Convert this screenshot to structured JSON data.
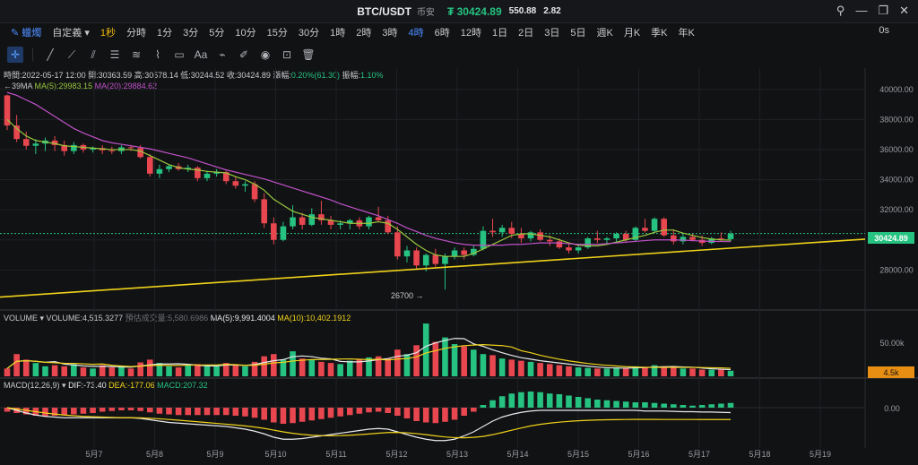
{
  "title": {
    "pair": "BTC/USDT",
    "exchange": "币安",
    "price": "₮ 30424.89",
    "change": "550.88",
    "percent": "2.82"
  },
  "toolbar": {
    "chart_type": "蠟燭",
    "custom": "自定義",
    "intervals": [
      "1秒",
      "分時",
      "1分",
      "3分",
      "5分",
      "10分",
      "15分",
      "30分",
      "1時",
      "2時",
      "3時",
      "4時",
      "6時",
      "12時",
      "1日",
      "2日",
      "3日",
      "5日",
      "週K",
      "月K",
      "季K",
      "年K"
    ],
    "active_interval": "4時",
    "highlight_interval": "1秒",
    "zero": "0s"
  },
  "info": {
    "time_label": "時間:",
    "time": "2022-05-17 12:00",
    "open_label": "開:",
    "open": "30363.59",
    "high_label": "高:",
    "high": "30578.14",
    "low_label": "低:",
    "low": "30244.52",
    "close_label": "收:",
    "close": "30424.89",
    "chg_label": "漲幅:",
    "chg": "0.20%(61.30)",
    "amp_label": "振幅:",
    "amp": "1.10%"
  },
  "legend": {
    "ma_prefix": "←39MA",
    "ma_partial": "MA",
    "ma5": "MA(5):29983.15",
    "ma20": "MA(20):29884.62",
    "volume": "VOLUME",
    "volume_val": "VOLUME:4,515.3277",
    "est": "預估成交量:5,580.6986",
    "vma5": "MA(5):9,991.4004",
    "vma10": "MA(10):10,402.1912",
    "macd": "MACD(12,26,9)",
    "dif": "DIF:-73.40",
    "dea": "DEA:-177.06",
    "macd_val": "MACD:207.32"
  },
  "annotations": {
    "low_marker": "26700 →",
    "price_tag": "30424.89",
    "vol_tag": "4.5k",
    "vol_axis": "50.00k",
    "macd_axis": "0.00"
  },
  "colors": {
    "up": "#26c281",
    "down": "#e8474f",
    "ma5": "#9ac83e",
    "ma20": "#c052c8",
    "trend": "#f0d21a",
    "bg": "#111214"
  },
  "chart_data": {
    "type": "candlestick",
    "x_labels": [
      "5月7",
      "5月8",
      "5月9",
      "5月10",
      "5月11",
      "5月12",
      "5月13",
      "5月14",
      "5月15",
      "5月16",
      "5月17",
      "5月18",
      "5月19"
    ],
    "y_ticks": [
      28000,
      30000,
      32000,
      34000,
      36000,
      38000,
      40000
    ],
    "ylim": [
      25400,
      40700
    ],
    "candles": [
      [
        39600,
        39650,
        37300,
        37600
      ],
      [
        37600,
        38300,
        36500,
        36700
      ],
      [
        36700,
        37200,
        36000,
        36250
      ],
      [
        36250,
        36700,
        35700,
        36400
      ],
      [
        36400,
        36800,
        35900,
        36600
      ],
      [
        36600,
        36900,
        35900,
        36300
      ],
      [
        36300,
        36600,
        35600,
        35900
      ],
      [
        35900,
        36500,
        35700,
        36300
      ],
      [
        36300,
        36400,
        35800,
        36000
      ],
      [
        36000,
        36200,
        35800,
        36100
      ],
      [
        36100,
        36300,
        35700,
        35950
      ],
      [
        35950,
        36200,
        35700,
        35900
      ],
      [
        35900,
        36300,
        35700,
        36150
      ],
      [
        36150,
        36300,
        35900,
        36100
      ],
      [
        36100,
        36300,
        35400,
        35500
      ],
      [
        35500,
        35700,
        34200,
        34400
      ],
      [
        34400,
        35000,
        34100,
        34700
      ],
      [
        34700,
        35000,
        34500,
        34900
      ],
      [
        34900,
        35100,
        34600,
        34700
      ],
      [
        34700,
        35000,
        34500,
        34800
      ],
      [
        34800,
        34900,
        33900,
        34100
      ],
      [
        34100,
        34600,
        33900,
        34400
      ],
      [
        34400,
        34700,
        34200,
        34500
      ],
      [
        34500,
        34600,
        33700,
        33900
      ],
      [
        33900,
        34200,
        33400,
        33600
      ],
      [
        33600,
        33900,
        33200,
        33700
      ],
      [
        33700,
        33900,
        32500,
        32700
      ],
      [
        32700,
        33100,
        30800,
        31100
      ],
      [
        31100,
        31500,
        29700,
        30000
      ],
      [
        30000,
        31200,
        29900,
        30900
      ],
      [
        30900,
        32300,
        30700,
        31500
      ],
      [
        31500,
        31800,
        30700,
        31000
      ],
      [
        31000,
        32100,
        30900,
        31700
      ],
      [
        31700,
        32600,
        31000,
        31300
      ],
      [
        31300,
        31600,
        30700,
        31000
      ],
      [
        31000,
        31300,
        30700,
        31100
      ],
      [
        31100,
        31400,
        30700,
        31300
      ],
      [
        31300,
        31500,
        30700,
        30900
      ],
      [
        30900,
        31600,
        30700,
        31500
      ],
      [
        31500,
        32200,
        31200,
        31300
      ],
      [
        31300,
        31600,
        30400,
        30500
      ],
      [
        30500,
        30900,
        28700,
        28900
      ],
      [
        28900,
        29600,
        28500,
        29300
      ],
      [
        29300,
        29500,
        28000,
        28300
      ],
      [
        28300,
        29100,
        27900,
        29000
      ],
      [
        29000,
        29400,
        28200,
        28400
      ],
      [
        28400,
        29100,
        26700,
        28900
      ],
      [
        28900,
        29500,
        28700,
        29300
      ],
      [
        29300,
        29500,
        28700,
        29000
      ],
      [
        29000,
        29600,
        28900,
        29400
      ],
      [
        29400,
        30900,
        29300,
        30600
      ],
      [
        30600,
        31400,
        30200,
        30500
      ],
      [
        30500,
        31000,
        30200,
        30800
      ],
      [
        30800,
        31200,
        30100,
        30400
      ],
      [
        30400,
        30800,
        29800,
        30100
      ],
      [
        30100,
        30600,
        29900,
        30500
      ],
      [
        30500,
        30700,
        29900,
        30000
      ],
      [
        30000,
        30300,
        29600,
        29900
      ],
      [
        29900,
        30100,
        29400,
        29500
      ],
      [
        29500,
        29800,
        29100,
        29300
      ],
      [
        29300,
        29700,
        29100,
        29500
      ],
      [
        29500,
        30200,
        29400,
        30100
      ],
      [
        30100,
        30600,
        29800,
        30000
      ],
      [
        30000,
        30200,
        29700,
        30100
      ],
      [
        30100,
        30500,
        29800,
        30400
      ],
      [
        30400,
        30600,
        29800,
        30000
      ],
      [
        30000,
        30900,
        29900,
        30800
      ],
      [
        30800,
        31400,
        30500,
        30600
      ],
      [
        30600,
        31500,
        30500,
        31400
      ],
      [
        31400,
        31500,
        30200,
        30300
      ],
      [
        30300,
        30700,
        29700,
        29900
      ],
      [
        29900,
        30400,
        29700,
        30200
      ],
      [
        30200,
        30400,
        29900,
        30000
      ],
      [
        30000,
        30300,
        29600,
        29800
      ],
      [
        29800,
        30200,
        29700,
        30100
      ],
      [
        30100,
        30500,
        29900,
        30050
      ],
      [
        30050,
        30600,
        29900,
        30400
      ]
    ],
    "volumes": [
      14,
      40,
      30,
      24,
      18,
      20,
      18,
      22,
      16,
      14,
      20,
      16,
      18,
      14,
      25,
      30,
      24,
      18,
      16,
      20,
      22,
      18,
      18,
      24,
      20,
      18,
      26,
      36,
      40,
      30,
      45,
      32,
      30,
      26,
      24,
      22,
      28,
      30,
      34,
      36,
      32,
      48,
      40,
      56,
      95,
      62,
      70,
      58,
      54,
      48,
      40,
      38,
      32,
      30,
      28,
      26,
      24,
      22,
      20,
      18,
      16,
      15,
      14,
      14,
      16,
      14,
      18,
      16,
      20,
      18,
      16,
      14,
      14,
      12,
      12,
      12,
      10
    ],
    "ma5": [
      38000,
      37400,
      36900,
      36600,
      36500,
      36400,
      36250,
      36200,
      36150,
      36100,
      36050,
      36000,
      36000,
      36000,
      35900,
      35600,
      35300,
      35000,
      34800,
      34700,
      34650,
      34550,
      34500,
      34450,
      34200,
      34000,
      33700,
      33300,
      32700,
      32300,
      31900,
      31700,
      31500,
      31400,
      31300,
      31200,
      31100,
      31100,
      31100,
      31200,
      31100,
      30700,
      30200,
      29700,
      29300,
      29000,
      28900,
      28900,
      28900,
      29100,
      29400,
      29700,
      30000,
      30300,
      30400,
      30400,
      30300,
      30200,
      30000,
      29800,
      29650,
      29600,
      29600,
      29700,
      29850,
      30000,
      30150,
      30300,
      30500,
      30650,
      30650,
      30450,
      30300,
      30150,
      30050,
      30000,
      29983
    ],
    "ma20": [
      39800,
      39600,
      39300,
      39000,
      38600,
      38200,
      37800,
      37400,
      37100,
      36850,
      36600,
      36450,
      36350,
      36250,
      36150,
      36050,
      35900,
      35750,
      35600,
      35450,
      35250,
      35050,
      34850,
      34650,
      34500,
      34350,
      34200,
      34050,
      33850,
      33650,
      33450,
      33250,
      33050,
      32850,
      32650,
      32400,
      32200,
      32000,
      31800,
      31600,
      31350,
      31100,
      30800,
      30550,
      30300,
      30100,
      29950,
      29800,
      29700,
      29650,
      29650,
      29650,
      29650,
      29700,
      29700,
      29750,
      29800,
      29800,
      29800,
      29750,
      29700,
      29700,
      29700,
      29750,
      29800,
      29850,
      29900,
      29950,
      30000,
      30000,
      30000,
      29980,
      29950,
      29920,
      29900,
      29890,
      29885
    ],
    "macd_hist": [
      -60,
      -80,
      -100,
      -120,
      -130,
      -120,
      -110,
      -100,
      -90,
      -80,
      -60,
      -50,
      -40,
      -40,
      -50,
      -70,
      -90,
      -100,
      -110,
      -110,
      -110,
      -110,
      -110,
      -110,
      -120,
      -130,
      -150,
      -180,
      -220,
      -240,
      -230,
      -210,
      -190,
      -170,
      -150,
      -130,
      -110,
      -90,
      -70,
      -60,
      -80,
      -120,
      -160,
      -200,
      -220,
      -230,
      -210,
      -180,
      -120,
      -60,
      40,
      110,
      170,
      210,
      230,
      240,
      230,
      210,
      200,
      180,
      160,
      140,
      120,
      110,
      100,
      90,
      80,
      80,
      70,
      60,
      50,
      40,
      30,
      40,
      50,
      60,
      70
    ],
    "macd_dif": [
      0,
      -40,
      -80,
      -110,
      -130,
      -140,
      -150,
      -150,
      -150,
      -150,
      -150,
      -150,
      -150,
      -150,
      -160,
      -180,
      -200,
      -220,
      -230,
      -240,
      -250,
      -260,
      -270,
      -280,
      -300,
      -320,
      -350,
      -390,
      -440,
      -470,
      -470,
      -460,
      -440,
      -420,
      -400,
      -380,
      -360,
      -340,
      -320,
      -310,
      -320,
      -360,
      -400,
      -440,
      -470,
      -490,
      -490,
      -470,
      -420,
      -360,
      -280,
      -200,
      -140,
      -100,
      -70,
      -50,
      -40,
      -40,
      -40,
      -40,
      -40,
      -40,
      -40,
      -40,
      -40,
      -40,
      -40,
      -50,
      -50,
      -50,
      -55,
      -60,
      -60,
      -65,
      -65,
      -70,
      -73
    ],
    "macd_dea": [
      0,
      -20,
      -40,
      -60,
      -80,
      -95,
      -110,
      -120,
      -130,
      -135,
      -140,
      -145,
      -148,
      -150,
      -152,
      -158,
      -166,
      -176,
      -187,
      -198,
      -210,
      -222,
      -234,
      -246,
      -258,
      -272,
      -288,
      -308,
      -334,
      -360,
      -382,
      -398,
      -410,
      -416,
      -418,
      -416,
      -410,
      -402,
      -392,
      -380,
      -370,
      -368,
      -374,
      -386,
      -402,
      -420,
      -436,
      -446,
      -448,
      -442,
      -428,
      -402,
      -370,
      -336,
      -302,
      -272,
      -248,
      -230,
      -216,
      -204,
      -195,
      -188,
      -183,
      -180,
      -178,
      -176,
      -175,
      -175,
      -175,
      -176,
      -176,
      -176,
      -176,
      -177,
      -177,
      -177,
      -177
    ]
  }
}
